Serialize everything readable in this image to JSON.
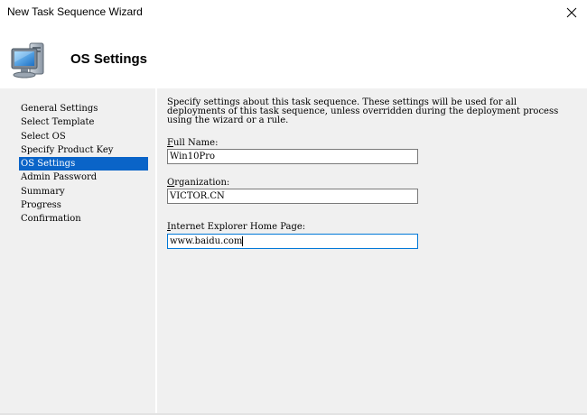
{
  "window": {
    "title": "New Task Sequence Wizard",
    "close_icon": "close-icon"
  },
  "header": {
    "icon": "computer-icon",
    "title": "OS Settings"
  },
  "sidebar": {
    "items": [
      {
        "label": "General Settings",
        "active": false
      },
      {
        "label": "Select Template",
        "active": false
      },
      {
        "label": "Select OS",
        "active": false
      },
      {
        "label": "Specify Product Key",
        "active": false
      },
      {
        "label": "OS Settings",
        "active": true
      },
      {
        "label": "Admin Password",
        "active": false
      },
      {
        "label": "Summary",
        "active": false
      },
      {
        "label": "Progress",
        "active": false
      },
      {
        "label": "Confirmation",
        "active": false
      }
    ]
  },
  "main": {
    "description_line1": "Specify settings about this task sequence.  These settings will be used for all",
    "description_line2": "deployments of this task sequence, unless overridden during the deployment process",
    "description_line3": "using the wizard or a rule.",
    "full_name": {
      "label_first": "F",
      "label_rest": "ull Name:",
      "value": "Win10Pro"
    },
    "organization": {
      "label_first": "O",
      "label_rest": "rganization:",
      "value": "VICTOR.CN"
    },
    "home_page": {
      "label_first": "I",
      "label_rest": "nternet Explorer Home Page:",
      "value": "www.baidu.com"
    }
  },
  "colors": {
    "selection": "#0a64c8",
    "focus_border": "#0078d7",
    "panel_background": "#f0f0f0"
  }
}
